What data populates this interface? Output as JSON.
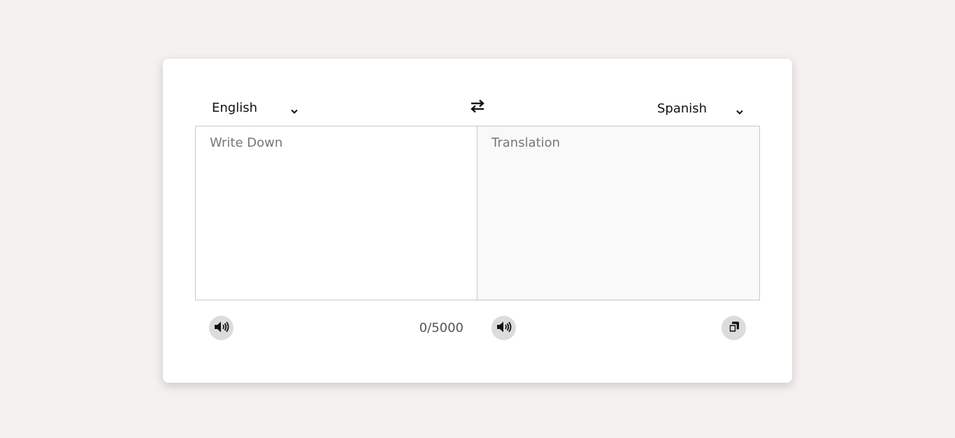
{
  "source_language": {
    "selected": "English"
  },
  "target_language": {
    "selected": "Spanish"
  },
  "input": {
    "placeholder": "Write Down",
    "value": ""
  },
  "output": {
    "placeholder": "Translation",
    "value": ""
  },
  "char_counter": "0/5000",
  "icons": {
    "swap": "swap-arrows-icon",
    "speak_source": "speaker-icon",
    "speak_target": "speaker-icon",
    "copy": "copy-icon"
  },
  "colors": {
    "page_background": "#f5f1f0",
    "card_background": "#ffffff",
    "button_background": "#dcdcdc",
    "output_background": "#f9f9f9"
  }
}
